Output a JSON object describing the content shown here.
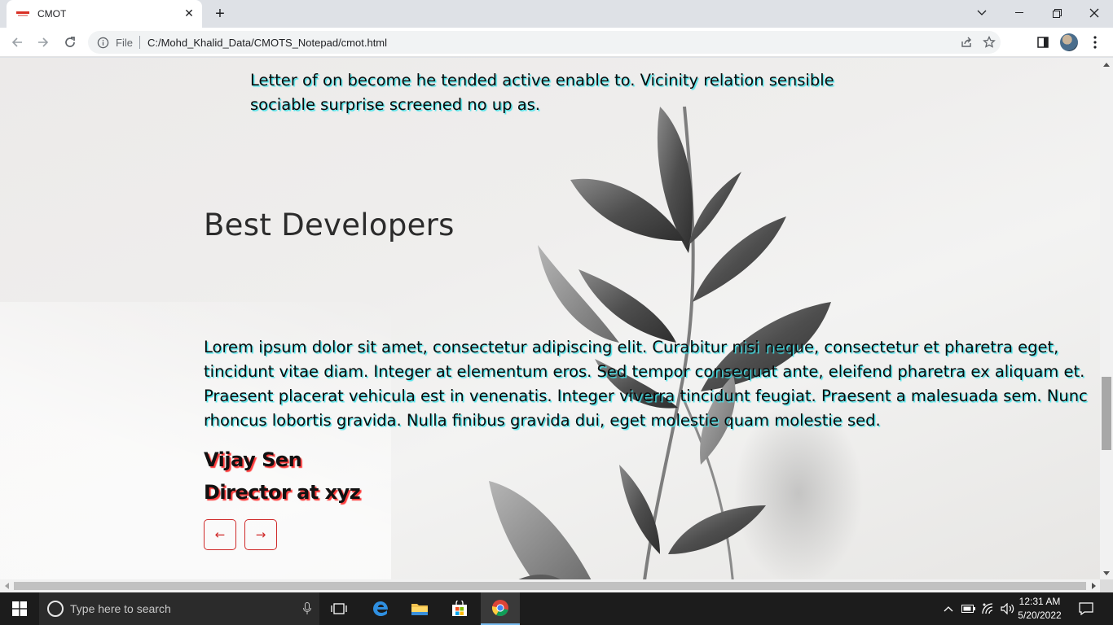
{
  "browser": {
    "tab_title": "CMOT",
    "address": {
      "scheme_label": "File",
      "url": "C:/Mohd_Khalid_Data/CMOTS_Notepad/cmot.html"
    }
  },
  "page": {
    "lead_paragraph": "Letter of on become he tended active enable to. Vicinity relation sensible sociable surprise screened no up as.",
    "section_title": "Best Developers",
    "testimonial": {
      "quote": "Lorem ipsum dolor sit amet, consectetur adipiscing elit. Curabitur nisi neque, consectetur et pharetra eget, tincidunt vitae diam. Integer at elementum eros. Sed tempor consequat ante, eleifend pharetra ex aliquam et. Praesent placerat vehicula est in venenatis. Integer viverra tincidunt feugiat. Praesent a malesuada sem. Nunc rhoncus lobortis gravida. Nulla finibus gravida dui, eget molestie quam molestie sed.",
      "author_name": "Vijay Sen",
      "author_role": "Director at xyz"
    },
    "carousel": {
      "prev_label": "←",
      "next_label": "→"
    }
  },
  "colors": {
    "quote_text_shadow": "#3fe3ea",
    "author_text_shadow": "#ff3b3b",
    "arrow_button_border": "#cf2a2a"
  },
  "taskbar": {
    "search_placeholder": "Type here to search",
    "clock_time": "12:31 AM",
    "clock_date": "5/20/2022",
    "pinned_apps": [
      "task-view-icon",
      "edge-icon",
      "file-explorer-icon",
      "microsoft-store-icon",
      "chrome-icon"
    ],
    "active_app": "chrome-icon"
  }
}
